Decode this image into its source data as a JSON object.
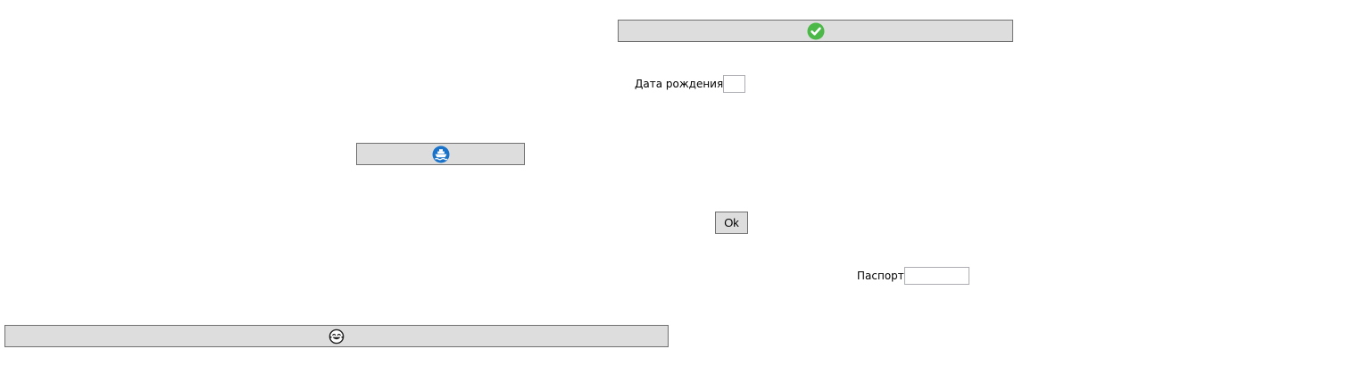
{
  "icons": {
    "confirm": "green-checkmark-icon",
    "ship": "blue-ship-icon",
    "face": "laughing-face-icon"
  },
  "colors": {
    "button_background": "#dddddd",
    "button_border": "#707070",
    "check_green": "#4cb848",
    "ship_blue": "#1a73c9"
  },
  "form": {
    "birth_date_label": "Дата рождения",
    "birth_date_value": "",
    "passport_label": "Паспорт",
    "passport_value": "",
    "ok_label": "Ok"
  }
}
